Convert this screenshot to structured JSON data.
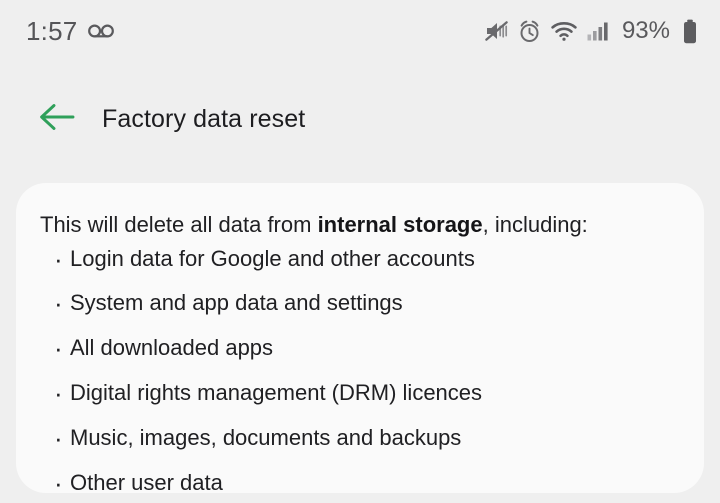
{
  "status_bar": {
    "time": "1:57",
    "voicemail_icon": "voicemail-icon",
    "mute_icon": "volume-mute-icon",
    "alarm_icon": "alarm-clock-icon",
    "wifi_icon": "wifi-icon",
    "signal_icon": "cellular-signal-icon",
    "battery_percent": "93%",
    "battery_icon": "battery-full-icon"
  },
  "app_bar": {
    "back_icon": "back-arrow-icon",
    "title": "Factory data reset",
    "accent_color": "#2fa05a"
  },
  "card": {
    "intro_prefix": "This will delete all data from ",
    "intro_emphasis": "internal storage",
    "intro_suffix": ", including:",
    "bullets": [
      "Login data for Google and other accounts",
      "System and app data and settings",
      "All downloaded apps",
      "Digital rights management (DRM) licences",
      "Music, images, documents and backups",
      "Other user data"
    ]
  },
  "colors": {
    "background": "#efefef",
    "card": "#fafafa",
    "text": "#202023",
    "status_text": "#59595c",
    "accent_green": "#2fa05a"
  }
}
